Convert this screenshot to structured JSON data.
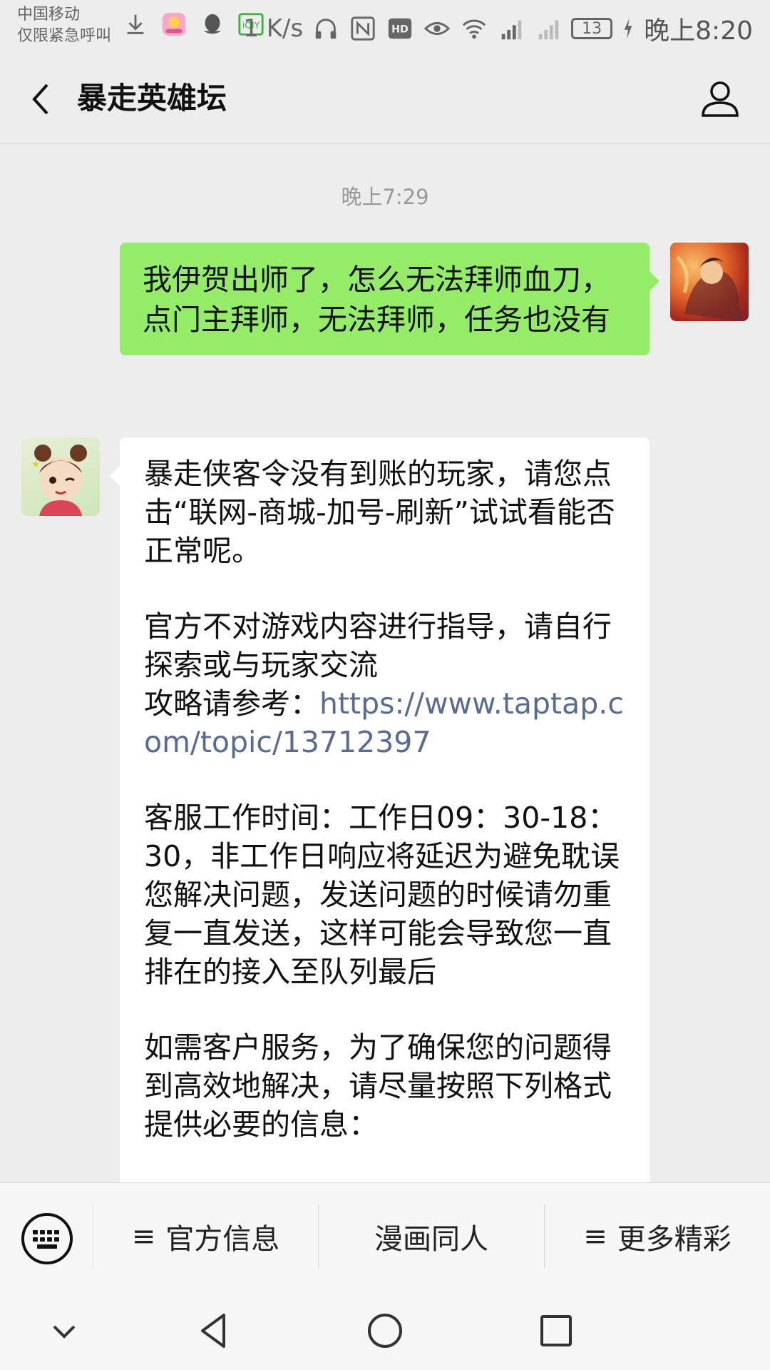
{
  "status_bar": {
    "carrier_line1": "中国移动",
    "carrier_line2": "仅限紧急呼叫",
    "net_speed": "1 K/s",
    "battery": "13",
    "time": "晚上8:20",
    "icons": [
      "download-icon",
      "app-icon",
      "qq-icon",
      "iqiyi-icon",
      "headphone-icon",
      "nfc-icon",
      "hd-icon",
      "eye-icon",
      "wifi-icon",
      "signal-4g-icon",
      "signal-icon",
      "charging-icon"
    ]
  },
  "header": {
    "title": "暴走英雄坛",
    "back_icon": "back-arrow-icon",
    "profile_icon": "person-icon"
  },
  "chat": {
    "timestamp": "晚上7:29",
    "sent_message": "我伊贺出师了，怎么无法拜师血刀，点门主拜师，无法拜师，任务也没有",
    "reply": {
      "p1": "暴走侠客令没有到账的玩家，请您点击“联网-商城-加号-刷新”试试看能否正常呢。",
      "p2_line1": "官方不对游戏内容进行指导，请自行探索或与玩家交流",
      "p2_prefix": "攻略请参考：",
      "p2_link": "https://www.taptap.com/topic/13712397",
      "p3": "客服工作时间：工作日09：30-18：30，非工作日响应将延迟为避免耽误您解决问题，发送问题的时候请勿重复一直发送，这样可能会导致您一直排在的接入至队列最后",
      "p4": "如需客户服务，为了确保您的问题得到高效地解决，请尽量按照下列格式提供必要的信息："
    }
  },
  "menu": {
    "items": [
      {
        "label": "官方信息",
        "has_menu_icon": true
      },
      {
        "label": "漫画同人",
        "has_menu_icon": false
      },
      {
        "label": "更多精彩",
        "has_menu_icon": true
      }
    ],
    "menu_symbol": "≡"
  },
  "colors": {
    "sent_bubble": "#95ec69",
    "received_bubble": "#ffffff",
    "link": "#576b95",
    "background": "#ededed"
  }
}
